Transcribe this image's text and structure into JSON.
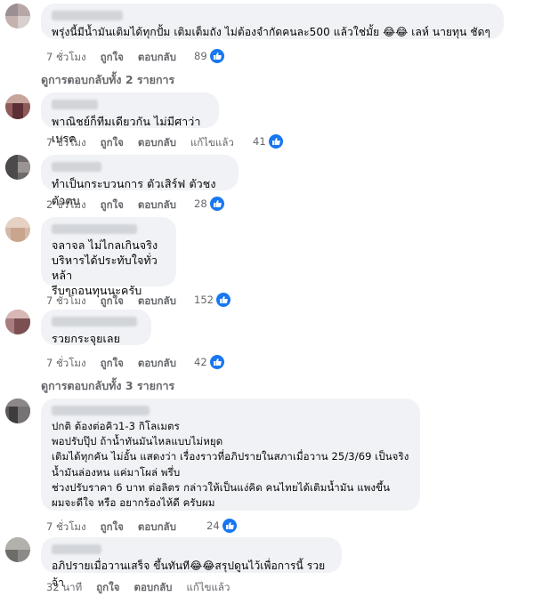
{
  "comments": [
    {
      "text": "พรุ่งนี้มีน้ำมันเติมได้ทุกปั้ม เติมเต็มถัง ไม่ต้องจำกัดคนละ500 แล้วใช่มั้ย 😂😂 เลห์ นายทุน ชัดๆ",
      "time": "7 ชั่วโมง",
      "like": "ถูกใจ",
      "reply": "ตอบกลับ",
      "edited": "",
      "reactions": "89"
    },
    {
      "text": "พาณิชย์ก็ทีมเดียวกัน ไม่มีศาว่าเบรค",
      "time": "7 ชั่วโมง",
      "like": "ถูกใจ",
      "reply": "ตอบกลับ",
      "edited": "แก้ไขแล้ว",
      "reactions": "41"
    },
    {
      "text": "ทำเป็นกระบวนการ ตัวเสิร์ฟ ตัวชง ตัวตบ",
      "time": "2 ชั่วโมง",
      "like": "ถูกใจ",
      "reply": "ตอบกลับ",
      "edited": "",
      "reactions": "28"
    },
    {
      "text": "จลาจล ไม่ไกลเกินจริง\nบริหารได้ประทับใจทั่วหล้า\nรีบๆถอนทุนนะครับ",
      "time": "7 ชั่วโมง",
      "like": "ถูกใจ",
      "reply": "ตอบกลับ",
      "edited": "",
      "reactions": "152"
    },
    {
      "text": "รวยกระจุยเลย",
      "time": "7 ชั่วโมง",
      "like": "ถูกใจ",
      "reply": "ตอบกลับ",
      "edited": "",
      "reactions": "42"
    },
    {
      "text": "ปกติ ต้องต่อคิว1-3 กิโลเมตร\nพอปรับปุ๊ป ถ้าน้ำทันมันไหลแบบไม่หยุด\nเติมได้ทุกคัน ไม่อั้น แสดงว่า เรื่องราวที่อภิปรายในสภาเมื่อวาน 25/3/69 เป็นจริง\nน้ำมันล่องหน แค่มาโผล่ พรึ่บ\nช่วงปรับราคา 6 บาท ต่อลิตร กล่าวให้เป็นแง่คิด คนไทยได้เติมน้ำมัน แพงขึ้น\nผมจะดีใจ หรือ อยากร้องไห้ดี ครับผม",
      "time": "7 ชั่วโมง",
      "like": "ถูกใจ",
      "reply": "ตอบกลับ",
      "edited": "",
      "reactions": "24"
    },
    {
      "text": "อภิปรายเมื่อวานเสร็จ ขึ้นทันที😂😂สรุปดูนไว้เพื่อการนี้ รวยจ้า",
      "time": "32 นาที",
      "like": "ถูกใจ",
      "reply": "ตอบกลับ",
      "edited": "แก้ไขแล้ว",
      "reactions": ""
    }
  ],
  "view_replies": [
    "ดูการตอบกลับทั้ง 2 รายการ",
    "ดูการตอบกลับทั้ง 3 รายการ"
  ],
  "colors": {
    "like_blue": "#1877f2",
    "bubble": "#f0f2f5",
    "meta": "#65676b"
  },
  "icons": {
    "reaction": "thumbs-up-icon"
  }
}
